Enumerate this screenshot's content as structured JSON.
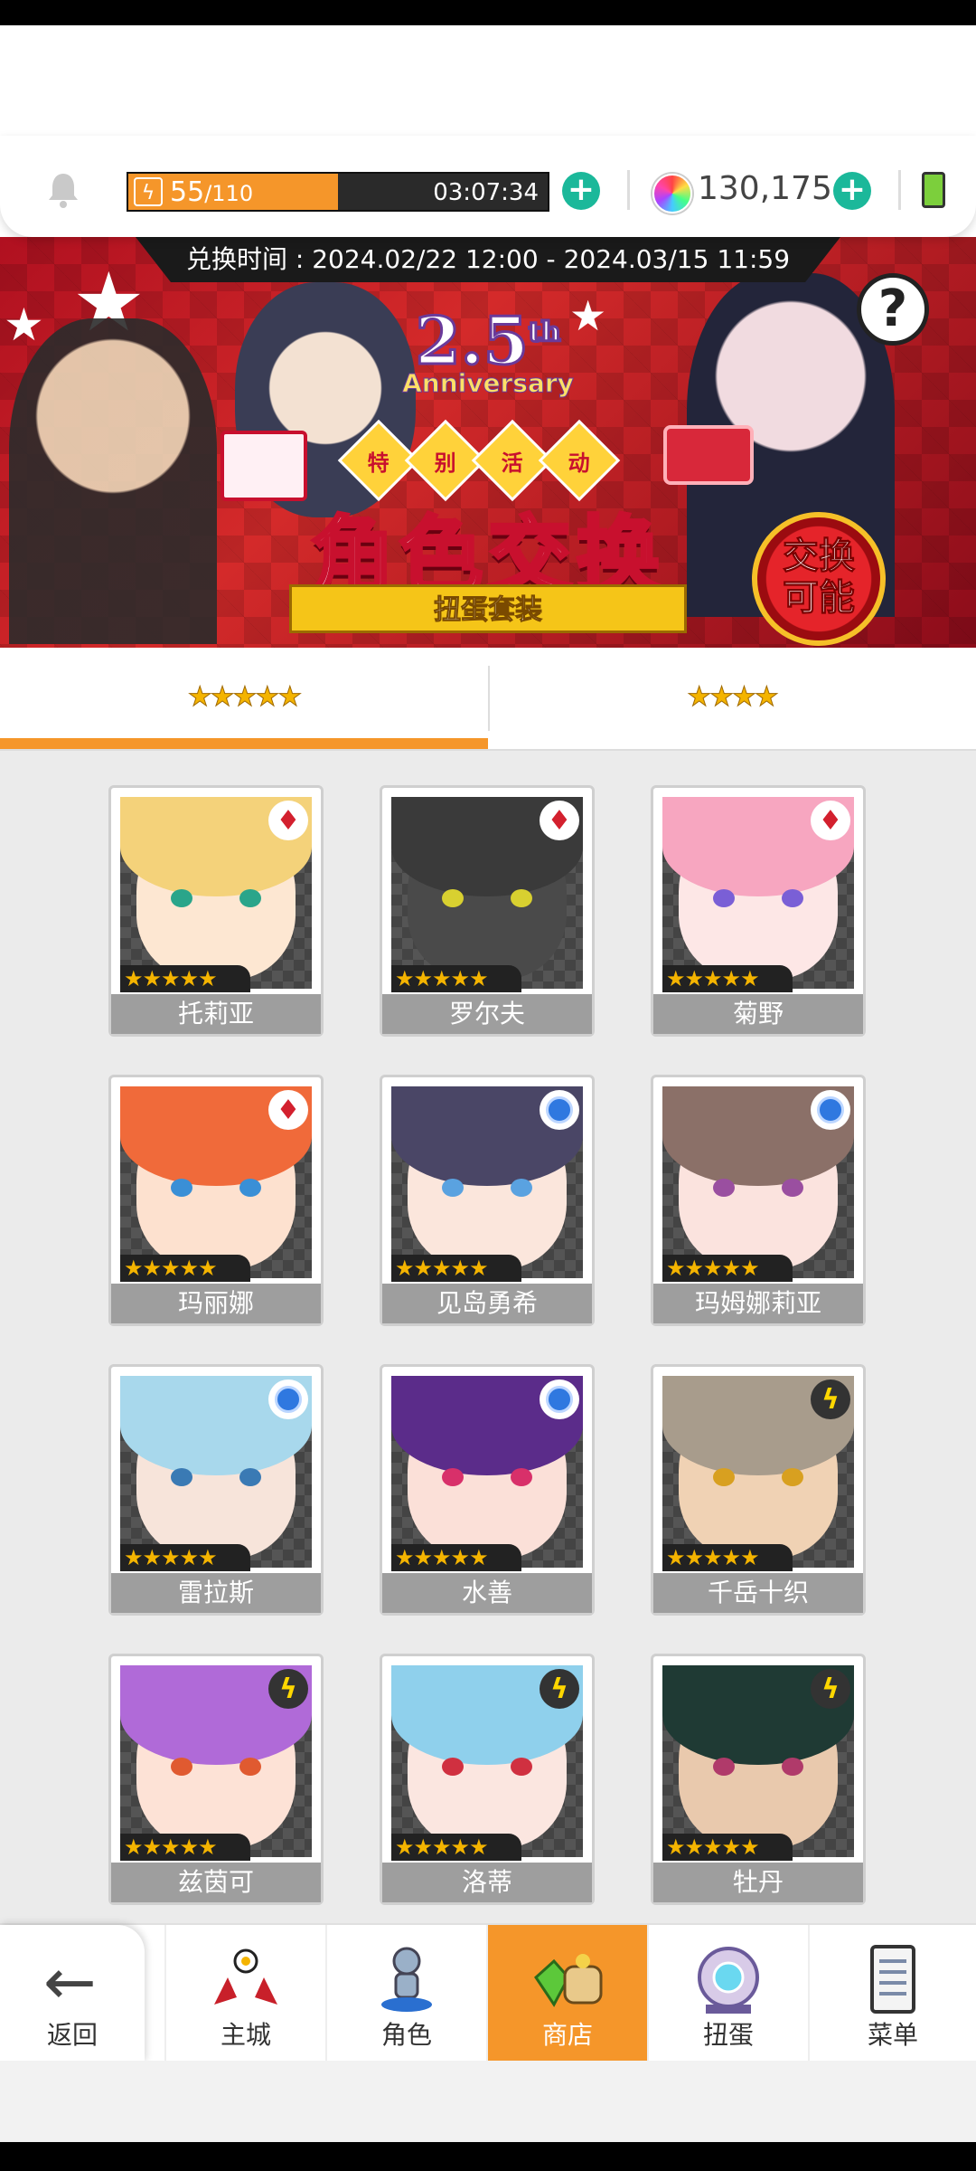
{
  "header": {
    "stamina_current": "55",
    "stamina_max": "/110",
    "stamina_fraction": 0.5,
    "stamina_timer": "03:07:34",
    "gems": "130,175",
    "colors": {
      "stamina_fill": "#f5962a",
      "plus": "#1bb89a",
      "battery": "#7ccf3c"
    }
  },
  "banner": {
    "exchange_time": "兑换时间 : 2024.02/22 12:00 - 2024.03/15 11:59",
    "anniversary_number": "2.5",
    "anniversary_suffix": "th",
    "anniversary_word": "Anniversary",
    "event_tags": [
      "特",
      "别",
      "活",
      "动"
    ],
    "title": "角色交换",
    "subtitle": "扭蛋套装",
    "badge": [
      "交换",
      "可能"
    ],
    "help": "?"
  },
  "tabs": [
    {
      "label": "★★★★★",
      "active": true
    },
    {
      "label": "★★★★",
      "active": false
    }
  ],
  "characters": [
    {
      "name": "托莉亚",
      "element": "diamond",
      "stars": "★★★★★",
      "hair": "#f4d27a",
      "skin": "#fde7d2",
      "eyes": "#2aa58a"
    },
    {
      "name": "罗尔夫",
      "element": "diamond",
      "stars": "★★★★★",
      "hair": "#3a3a3a",
      "skin": "#4a4a4a",
      "eyes": "#d8d030"
    },
    {
      "name": "菊野",
      "element": "diamond",
      "stars": "★★★★★",
      "hair": "#f7a6c0",
      "skin": "#fde7e6",
      "eyes": "#7a5fd6"
    },
    {
      "name": "玛丽娜",
      "element": "diamond",
      "stars": "★★★★★",
      "hair": "#f06a3a",
      "skin": "#fde1cf",
      "eyes": "#3a8fd6"
    },
    {
      "name": "见岛勇希",
      "element": "circle",
      "stars": "★★★★★",
      "hair": "#4a4666",
      "skin": "#fbe6dc",
      "eyes": "#5aa2e0"
    },
    {
      "name": "玛姆娜莉亚",
      "element": "circle",
      "stars": "★★★★★",
      "hair": "#8b7068",
      "skin": "#fbe3de",
      "eyes": "#9a4fa0"
    },
    {
      "name": "雷拉斯",
      "element": "circle",
      "stars": "★★★★★",
      "hair": "#a8d8ec",
      "skin": "#f7e4da",
      "eyes": "#3a7ab4"
    },
    {
      "name": "水善",
      "element": "circle",
      "stars": "★★★★★",
      "hair": "#5b2c8a",
      "skin": "#fbe0d8",
      "eyes": "#d8306a"
    },
    {
      "name": "千岳十织",
      "element": "bolt",
      "stars": "★★★★★",
      "hair": "#a89c8c",
      "skin": "#f0d2b4",
      "eyes": "#d8a020"
    },
    {
      "name": "兹茵可",
      "element": "bolt",
      "stars": "★★★★★",
      "hair": "#b06ad8",
      "skin": "#fde2d6",
      "eyes": "#e05a30"
    },
    {
      "name": "洛蒂",
      "element": "bolt",
      "stars": "★★★★★",
      "hair": "#8fd0ec",
      "skin": "#fbe6e0",
      "eyes": "#d03040"
    },
    {
      "name": "牡丹",
      "element": "bolt",
      "stars": "★★★★★",
      "hair": "#1f3a34",
      "skin": "#e9c9ad",
      "eyes": "#b03a6a"
    }
  ],
  "bottom_nav": {
    "back": "返回",
    "items": [
      {
        "label": "主城",
        "icon": "castle-icon",
        "active": false
      },
      {
        "label": "角色",
        "icon": "character-icon",
        "active": false
      },
      {
        "label": "商店",
        "icon": "shop-icon",
        "active": true
      },
      {
        "label": "扭蛋",
        "icon": "gacha-icon",
        "active": false
      },
      {
        "label": "菜单",
        "icon": "menu-icon",
        "active": false
      }
    ]
  }
}
